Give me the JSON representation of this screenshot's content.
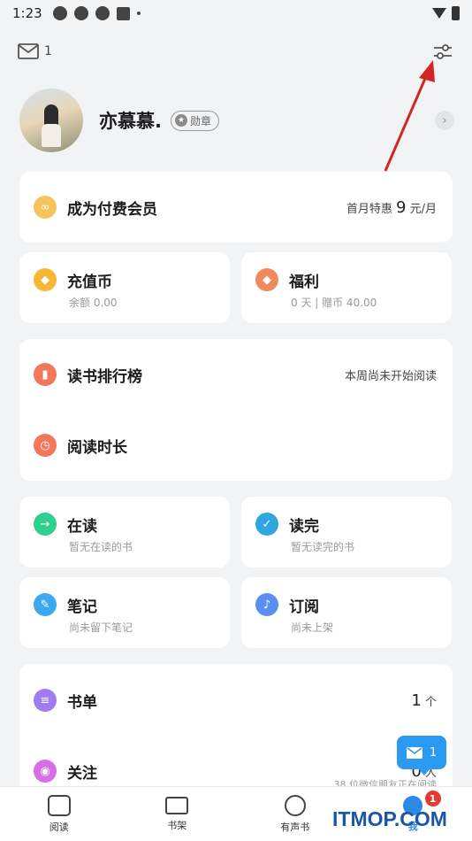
{
  "status_bar": {
    "time": "1:23"
  },
  "top": {
    "mail_count": "1"
  },
  "profile": {
    "username": "亦慕慕.",
    "badge_label": "勋章"
  },
  "vip": {
    "title": "成为付费会员",
    "promo_prefix": "首月特惠",
    "promo_price": "9",
    "promo_unit": "元/月"
  },
  "coins": {
    "title": "充值币",
    "sub": "余额 0.00"
  },
  "welfare": {
    "title": "福利",
    "sub": "0 天 | 赠币 40.00"
  },
  "ranking": {
    "title": "读书排行榜",
    "status": "本周尚未开始阅读"
  },
  "duration": {
    "title": "阅读时长"
  },
  "reading": {
    "title": "在读",
    "sub": "暂无在读的书"
  },
  "finished": {
    "title": "读完",
    "sub": "暂无读完的书"
  },
  "notes": {
    "title": "笔记",
    "sub": "尚未留下笔记"
  },
  "subscribe": {
    "title": "订阅",
    "sub": "尚未上架"
  },
  "booklist": {
    "title": "书单",
    "count": "1",
    "unit": "个"
  },
  "follow": {
    "title": "关注",
    "count": "0",
    "unit": "人",
    "sub": "38 位微信朋友正在阅读"
  },
  "float_mail": {
    "count": "1"
  },
  "nav": {
    "items": [
      {
        "label": "阅读"
      },
      {
        "label": "书架"
      },
      {
        "label": "有声书"
      },
      {
        "label": "我",
        "badge": "1"
      }
    ]
  },
  "watermark": "ITMOP.COM",
  "colors": {
    "accent": "#2b8ae6",
    "arrow": "#d42525"
  }
}
